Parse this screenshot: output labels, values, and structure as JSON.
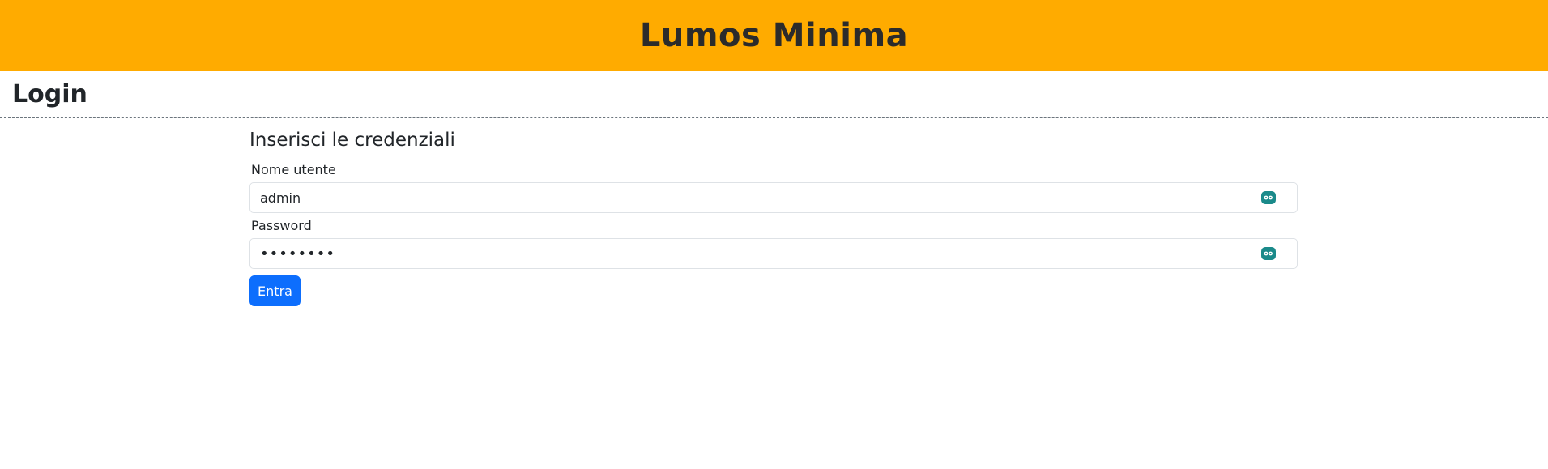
{
  "header": {
    "app_title": "Lumos Minima"
  },
  "page": {
    "title": "Login"
  },
  "login_form": {
    "heading": "Inserisci le credenziali",
    "username": {
      "label": "Nome utente",
      "value": "admin",
      "icon": "password-manager-icon"
    },
    "password": {
      "label": "Password",
      "value": "••••••••",
      "icon": "password-manager-icon"
    },
    "submit_label": "Entra"
  },
  "colors": {
    "header_bg": "#ffab00",
    "primary_button": "#0d6efd",
    "icon_accent": "#1a8a8a"
  }
}
